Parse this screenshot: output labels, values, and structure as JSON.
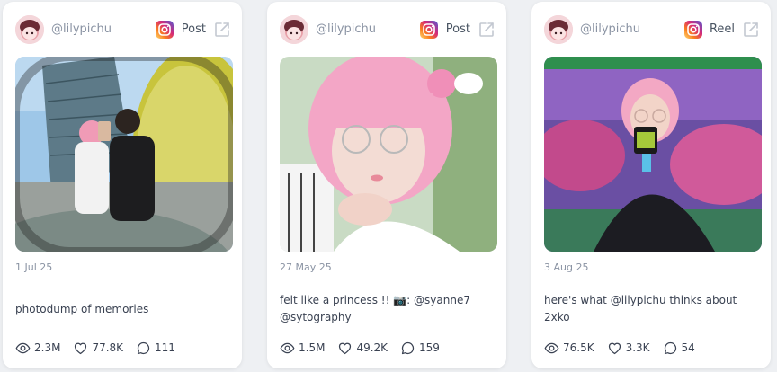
{
  "colors": {
    "page_bg": "#eef0f3",
    "card_bg": "#ffffff",
    "muted_text": "#8a93a3",
    "body_text": "#3a4252",
    "instagram_gradient": [
      "#feda75",
      "#fa7e1e",
      "#d62976",
      "#962fbf",
      "#4f5bd5"
    ]
  },
  "posts": [
    {
      "username": "@lilypichu",
      "platform_icon": "instagram-icon",
      "type": "Post",
      "date": "1 Jul 25",
      "caption": "photodump of memories",
      "stats": {
        "views": "2.3M",
        "likes": "77.8K",
        "comments": "111"
      }
    },
    {
      "username": "@lilypichu",
      "platform_icon": "instagram-icon",
      "type": "Post",
      "date": "27 May 25",
      "caption": "felt like a princess !! 📷: @syanne7 @sytography",
      "stats": {
        "views": "1.5M",
        "likes": "49.2K",
        "comments": "159"
      }
    },
    {
      "username": "@lilypichu",
      "platform_icon": "instagram-icon",
      "type": "Reel",
      "date": "3 Aug 25",
      "caption": "here's what @lilypichu thinks about 2xko",
      "stats": {
        "views": "76.5K",
        "likes": "3.3K",
        "comments": "54"
      }
    }
  ]
}
